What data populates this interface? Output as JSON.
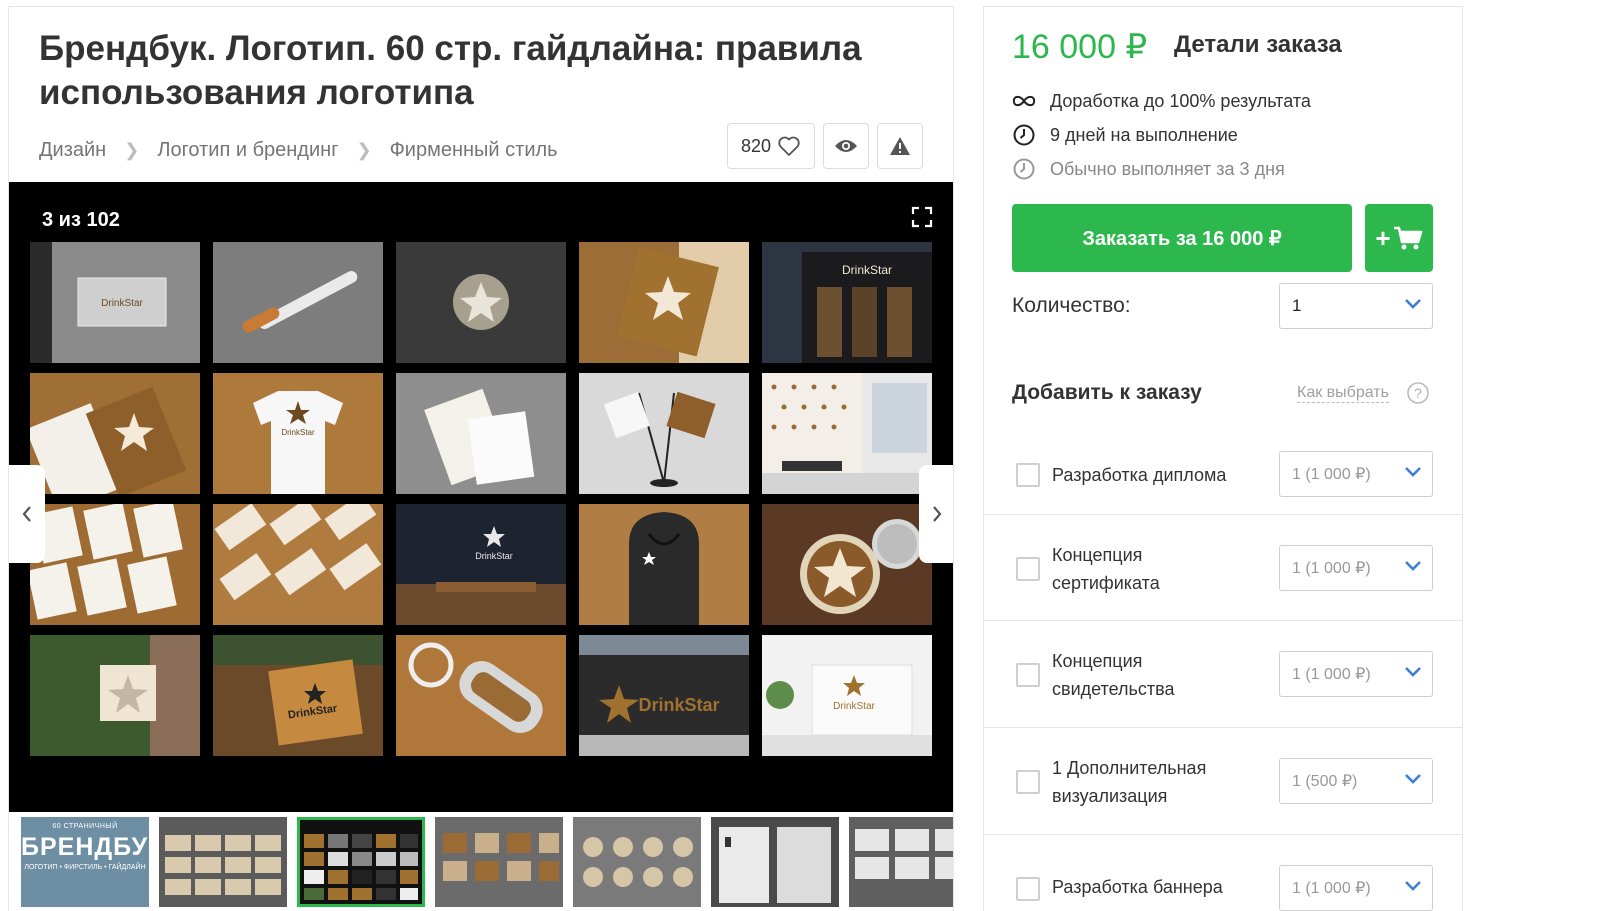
{
  "product": {
    "title": "Брендбук. Логотип. 60 стр. гайдлайна: правила использования логотипа",
    "breadcrumbs": [
      "Дизайн",
      "Логотип и брендинг",
      "Фирменный стиль"
    ],
    "favorites_count": "820"
  },
  "gallery": {
    "counter": "3 из 102",
    "tile_labels": [
      "DrinkStar",
      "DrinkStar",
      "DrinkStar",
      "DrinkStar",
      "DrinkStar",
      "DrinkStar",
      "DrinkStar"
    ],
    "thumb_cover": {
      "small": "60 СТРАНИЧНЫЙ",
      "big": "БРЕНДБУК",
      "sub": "ЛОГОТИП • ФИРСТИЛЬ • ГАЙДЛАЙН"
    }
  },
  "order": {
    "price": "16 000 ₽",
    "title": "Детали заказа",
    "features": [
      {
        "icon": "infinity-icon",
        "text": "Доработка до 100% результата"
      },
      {
        "icon": "clock-icon",
        "text": "9 дней на выполнение"
      },
      {
        "icon": "clock-icon",
        "text": "Обычно выполняет за 3 дня"
      }
    ],
    "order_button": "Заказать за 16 000 ₽",
    "cart_plus": "+",
    "quantity_label": "Количество:",
    "quantity_value": "1"
  },
  "addons": {
    "title": "Добавить к заказу",
    "how_to_choose": "Как выбрать",
    "help_glyph": "?",
    "items": [
      {
        "label": "Разработка диплома",
        "option": "1 (1 000 ₽)"
      },
      {
        "label": "Концепция сертификата",
        "option": "1 (1 000 ₽)"
      },
      {
        "label": "Концепция свидетельства",
        "option": "1 (1 000 ₽)"
      },
      {
        "label": "1 Дополнительная визуализация",
        "option": "1 (500 ₽)"
      },
      {
        "label": "Разработка баннера",
        "option": "1 (1 000 ₽)"
      }
    ]
  },
  "colors": {
    "accent_green": "#2db84d",
    "chevron_blue": "#3f7fd4",
    "brand_brown": "#9a6b34"
  }
}
